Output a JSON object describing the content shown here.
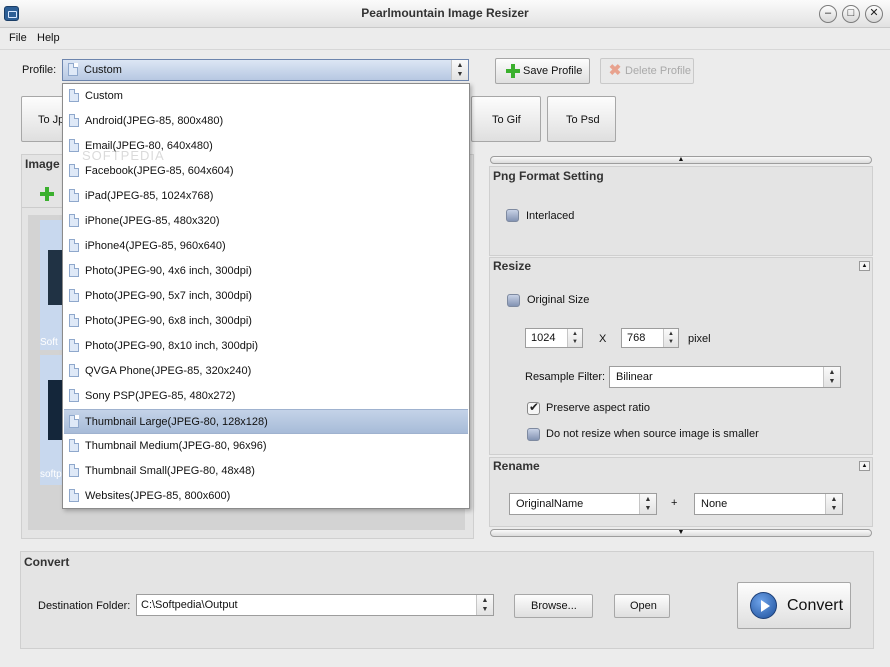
{
  "app": {
    "title": "Pearlmountain Image Resizer"
  },
  "window_controls": {
    "minimize": "–",
    "maximize": "□",
    "close": "✕"
  },
  "menu": {
    "file": "File",
    "help": "Help"
  },
  "profile": {
    "label": "Profile:",
    "selected": "Custom",
    "save_label": "Save Profile",
    "delete_label": "Delete Profile",
    "options": [
      "Custom",
      "Android(JPEG-85, 800x480)",
      "Email(JPEG-80, 640x480)",
      "Facebook(JPEG-85, 604x604)",
      "iPad(JPEG-85, 1024x768)",
      "iPhone(JPEG-85, 480x320)",
      "iPhone4(JPEG-85, 960x640)",
      "Photo(JPEG-90, 4x6 inch, 300dpi)",
      "Photo(JPEG-90, 5x7 inch, 300dpi)",
      "Photo(JPEG-90, 6x8 inch, 300dpi)",
      "Photo(JPEG-90, 8x10 inch, 300dpi)",
      "QVGA Phone(JPEG-85, 320x240)",
      "Sony PSP(JPEG-85, 480x272)",
      "Thumbnail Large(JPEG-80, 128x128)",
      "Thumbnail Medium(JPEG-80, 96x96)",
      "Thumbnail Small(JPEG-80, 48x48)",
      "Websites(JPEG-85, 800x600)"
    ],
    "highlighted": "Thumbnail Large(JPEG-80, 128x128)"
  },
  "format_buttons": {
    "jpg": "To Jp",
    "gif": "To Gif",
    "psd": "To Psd"
  },
  "images_panel": {
    "title": "Image",
    "watermark1": "Soft",
    "watermark2": "softp"
  },
  "png_settings": {
    "title": "Png Format Setting",
    "interlaced": "Interlaced"
  },
  "resize": {
    "title": "Resize",
    "original_size": "Original Size",
    "width": "1024",
    "x": "X",
    "height": "768",
    "unit": "pixel",
    "resample_label": "Resample Filter:",
    "resample_value": "Bilinear",
    "preserve": "Preserve aspect ratio",
    "no_upscale": "Do not resize when source image is smaller"
  },
  "rename": {
    "title": "Rename",
    "name_value": "OriginalName",
    "plus": "+",
    "suffix_value": "None"
  },
  "convert": {
    "title": "Convert",
    "dest_label": "Destination Folder:",
    "dest_value": "C:\\Softpedia\\Output",
    "browse": "Browse...",
    "open": "Open",
    "convert_label": "Convert"
  },
  "watermark": "SOFTPEDIA"
}
